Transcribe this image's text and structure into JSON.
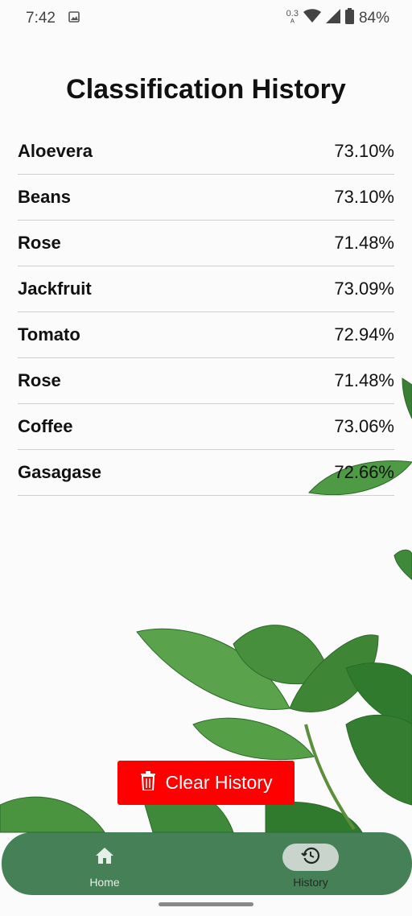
{
  "status_bar": {
    "time": "7:42",
    "net_speed_value": "0.3",
    "net_speed_unit": "ᴬ",
    "battery": "84%"
  },
  "page": {
    "title": "Classification History"
  },
  "history": [
    {
      "name": "Aloevera",
      "percent": "73.10%"
    },
    {
      "name": "Beans",
      "percent": "73.10%"
    },
    {
      "name": "Rose",
      "percent": "71.48%"
    },
    {
      "name": "Jackfruit",
      "percent": "73.09%"
    },
    {
      "name": "Tomato",
      "percent": "72.94%"
    },
    {
      "name": "Rose",
      "percent": "71.48%"
    },
    {
      "name": "Coffee",
      "percent": "73.06%"
    },
    {
      "name": "Gasagase",
      "percent": "72.66%"
    }
  ],
  "actions": {
    "clear_label": "Clear History",
    "clear_color": "#ff0000"
  },
  "bottom_nav": {
    "items": [
      {
        "label": "Home",
        "icon": "home-icon",
        "selected": false
      },
      {
        "label": "History",
        "icon": "history-icon",
        "selected": true
      }
    ],
    "color": "#2c6e40"
  },
  "icons": {
    "gallery": "image-icon",
    "wifi": "wifi-icon",
    "cellular": "signal-icon",
    "battery": "battery-icon",
    "trash": "trash-icon"
  }
}
